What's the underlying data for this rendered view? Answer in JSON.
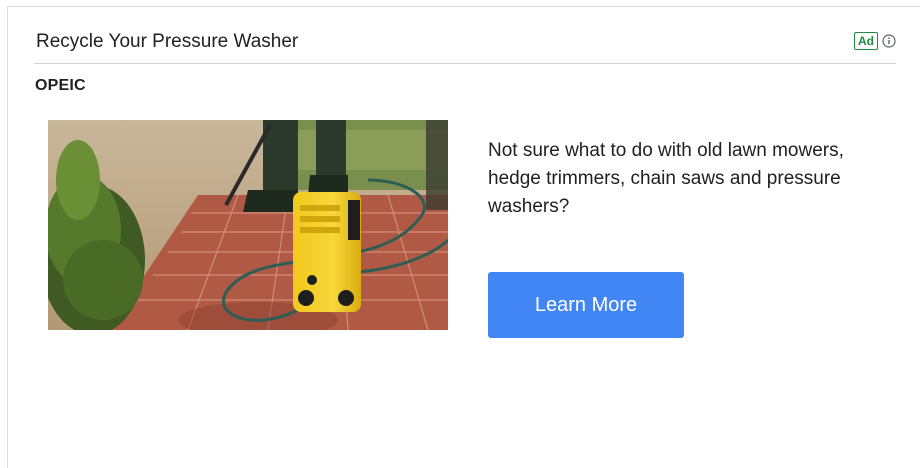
{
  "ad": {
    "title": "Recycle Your Pressure Washer",
    "badge": "Ad",
    "info_icon": "info-circle-icon",
    "advertiser": "OPEIC",
    "image": "pressure-washer-photo",
    "body": "Not sure what to do with old lawn mowers, hedge trimmers, chain saws and pressure washers?",
    "cta_label": "Learn More"
  },
  "colors": {
    "cta": "#4285f4",
    "badge": "#1e8e3e"
  }
}
